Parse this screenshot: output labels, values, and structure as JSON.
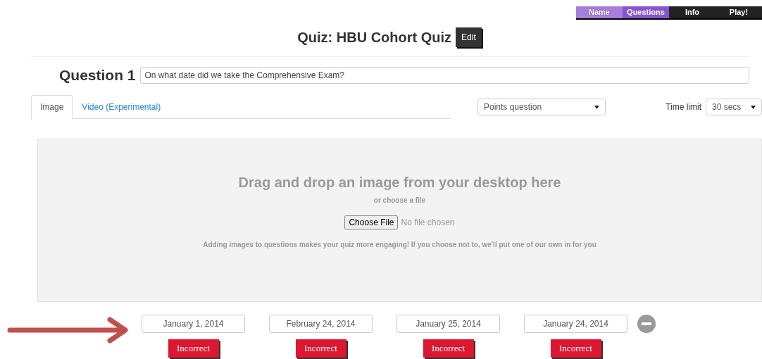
{
  "steps": [
    {
      "label": "Name",
      "selected": false,
      "completed": true
    },
    {
      "label": "Questions",
      "selected": true,
      "completed": false
    },
    {
      "label": "Info",
      "selected": false,
      "completed": false
    },
    {
      "label": "Play!",
      "selected": false,
      "completed": false
    }
  ],
  "title": "Quiz: HBU Cohort Quiz",
  "edit_button": "Edit",
  "question": {
    "label": "Question 1",
    "value": "On what date did we take the Comprehensive Exam?"
  },
  "tabs": [
    {
      "label": "Image",
      "selected": true
    },
    {
      "label": "Video (Experimental)",
      "selected": false
    }
  ],
  "question_type": "Points question",
  "time_limit": {
    "label": "Time limit",
    "value": "30 secs"
  },
  "dropzone": {
    "heading": "Drag and drop an image from your desktop here",
    "subheading": "or choose a file",
    "file_button": "Choose File",
    "file_status": "No file chosen",
    "hint": "Adding images to questions makes your quiz more engaging! If you choose not to, we'll put one of our own in for you"
  },
  "answers": [
    {
      "value": "January 1, 2014",
      "correct": false,
      "label": "Incorrect"
    },
    {
      "value": "February 24, 2014",
      "correct": false,
      "label": "Incorrect"
    },
    {
      "value": "January 25, 2014",
      "correct": false,
      "label": "Incorrect"
    },
    {
      "value": "January 24, 2014",
      "correct": false,
      "label": "Incorrect"
    }
  ]
}
